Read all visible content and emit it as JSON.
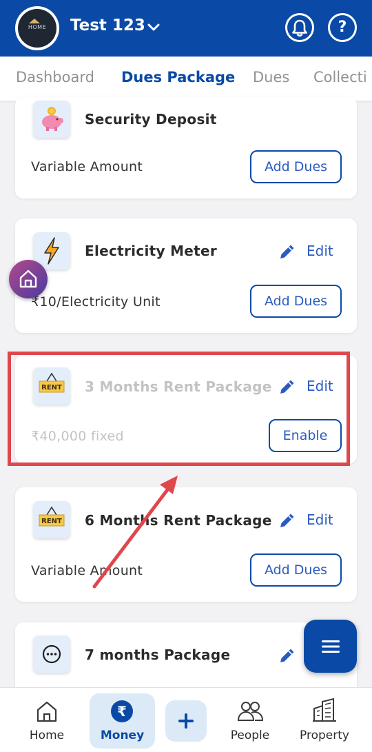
{
  "header": {
    "account_name": "Test 123",
    "avatar_text": "HOME",
    "bell_icon": "bell-icon",
    "help_label": "?"
  },
  "tabs": [
    {
      "label": "Dashboard",
      "active": false
    },
    {
      "label": "Dues Package",
      "active": true
    },
    {
      "label": "Dues",
      "active": false
    },
    {
      "label": "Collecti",
      "active": false
    }
  ],
  "cards": [
    {
      "title": "Security Deposit",
      "subtitle": "Variable Amount",
      "action": "Add Dues",
      "icon": "piggy-bank-icon",
      "has_edit": false,
      "enabled": true
    },
    {
      "title": "Electricity Meter",
      "subtitle": "₹10/Electricity Unit",
      "action": "Add Dues",
      "icon": "lightning-icon",
      "has_edit": true,
      "enabled": true
    },
    {
      "title": "3 Months Rent Package",
      "subtitle": "₹40,000 fixed",
      "action": "Enable",
      "icon": "rent-sign-icon",
      "icon_text": "RENT",
      "has_edit": true,
      "enabled": false
    },
    {
      "title": "6 Months Rent Package",
      "subtitle": "Variable Amount",
      "action": "Add Dues",
      "icon": "rent-sign-icon",
      "icon_text": "RENT",
      "has_edit": true,
      "enabled": true
    },
    {
      "title": "7 months Package",
      "icon": "more-icon",
      "has_edit": true,
      "enabled": true
    }
  ],
  "edit_label": "Edit",
  "bottom_nav": [
    {
      "label": "Home",
      "icon": "home-icon"
    },
    {
      "label": "Money",
      "icon": "rupee-icon",
      "active": true
    },
    {
      "label": "",
      "icon": "plus-icon"
    },
    {
      "label": "People",
      "icon": "people-icon"
    },
    {
      "label": "Property",
      "icon": "building-icon"
    }
  ],
  "colors": {
    "primary": "#0a4aa6",
    "link": "#2a5bc2",
    "highlight": "#e0474c",
    "disabled_text": "#c3c3c3"
  }
}
